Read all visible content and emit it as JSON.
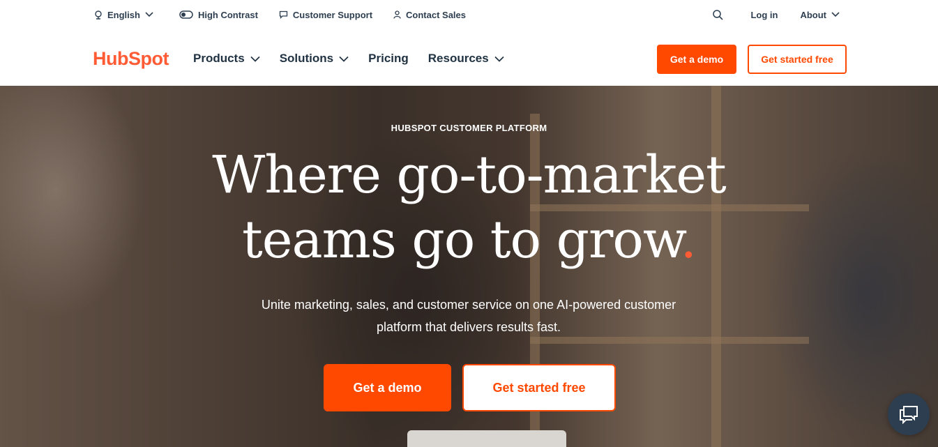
{
  "utility": {
    "language": "English",
    "high_contrast": "High Contrast",
    "customer_support": "Customer Support",
    "contact_sales": "Contact Sales",
    "log_in": "Log in",
    "about": "About"
  },
  "nav": {
    "logo": "HubSpot",
    "items": [
      {
        "label": "Products",
        "has_dropdown": true
      },
      {
        "label": "Solutions",
        "has_dropdown": true
      },
      {
        "label": "Pricing",
        "has_dropdown": false
      },
      {
        "label": "Resources",
        "has_dropdown": true
      }
    ],
    "demo_button": "Get a demo",
    "free_button": "Get started free"
  },
  "hero": {
    "eyebrow": "HUBSPOT CUSTOMER PLATFORM",
    "headline_line1": "Where go-to-market",
    "headline_line2": "teams go to grow",
    "headline_dot": ".",
    "subtext": "Unite marketing, sales, and customer service on one AI-powered customer platform that delivers results fast.",
    "demo_button": "Get a demo",
    "free_button": "Get started free"
  },
  "colors": {
    "brand_orange": "#ff4800",
    "logo_orange": "#ff5c35",
    "text_dark": "#213343",
    "chat_bg": "#2d3e50"
  },
  "icons": {
    "language": "globe-icon",
    "high_contrast": "toggle-icon",
    "support": "chat-bubble-icon",
    "sales": "person-icon",
    "search": "search-icon",
    "chat": "chat-icon"
  }
}
